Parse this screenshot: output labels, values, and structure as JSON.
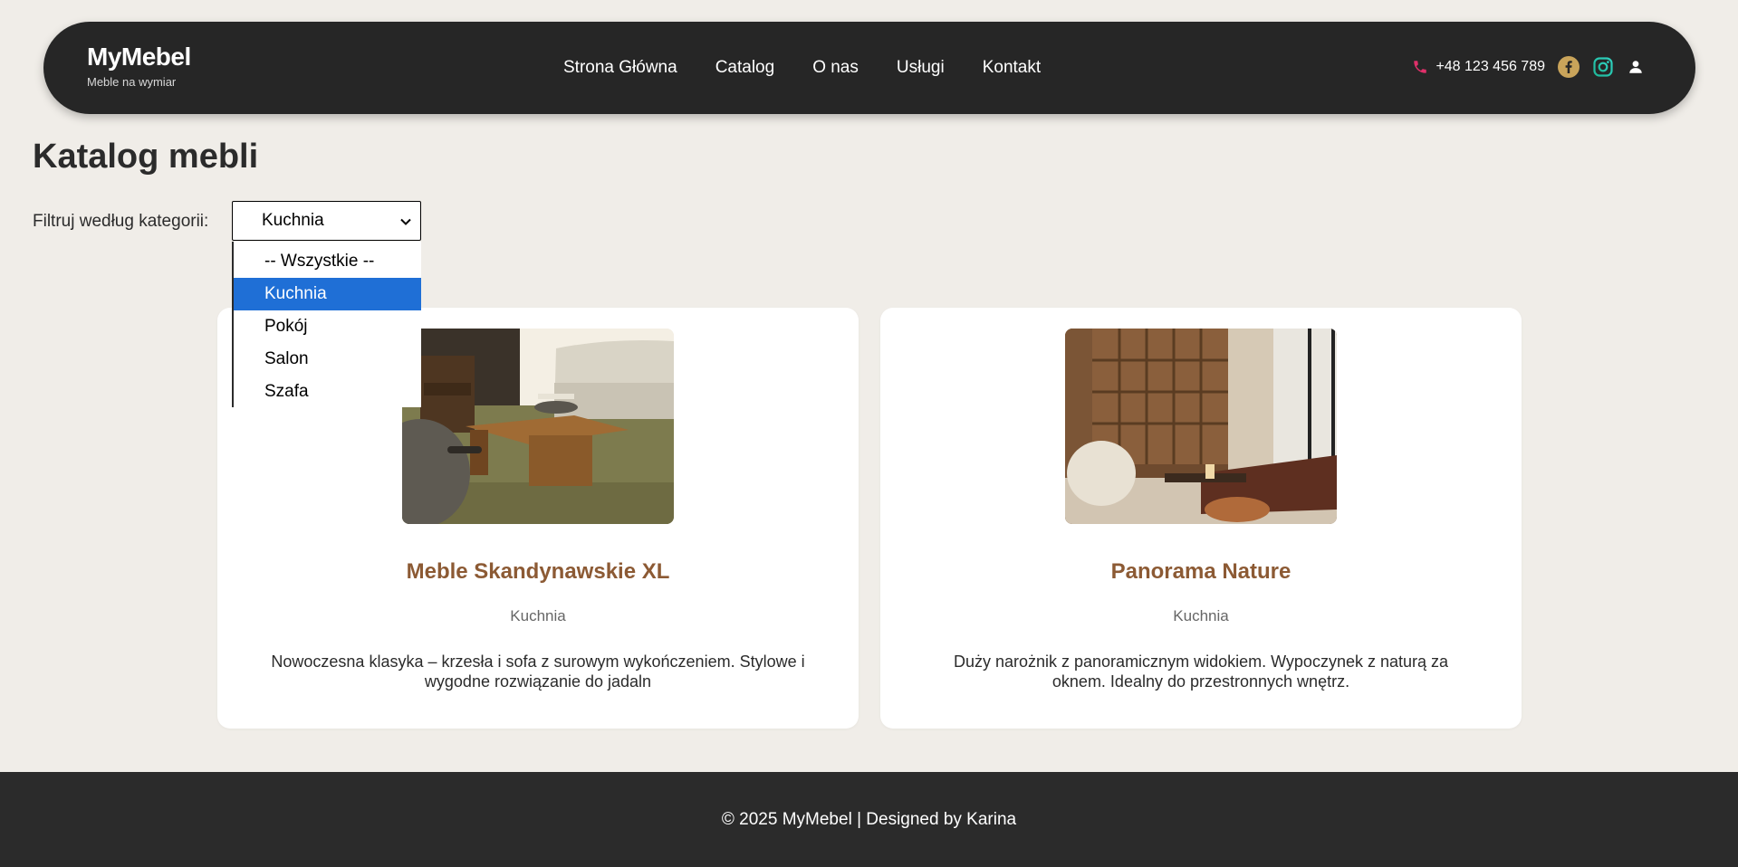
{
  "header": {
    "brand_name": "MyMebel",
    "brand_tagline": "Meble na wymiar",
    "nav": [
      "Strona Główna",
      "Catalog",
      "O nas",
      "Usługi",
      "Kontakt"
    ],
    "phone": "+48 123 456 789",
    "icons": [
      "phone-icon",
      "facebook-icon",
      "instagram-icon",
      "user-icon"
    ]
  },
  "main": {
    "title": "Katalog mebli",
    "filter_label": "Filtruj według kategorii:",
    "filter_selected": "Kuchnia",
    "filter_options": [
      "-- Wszystkie --",
      "Kuchnia",
      "Pokój",
      "Salon",
      "Szafa"
    ],
    "cards": [
      {
        "title": "Meble Skandynawskie XL",
        "category": "Kuchnia",
        "description": "Nowoczesna klasyka – krzesła i sofa z surowym wykończeniem. Stylowe i wygodne rozwiązanie do jadaln"
      },
      {
        "title": "Panorama Nature",
        "category": "Kuchnia",
        "description": "Duży narożnik z panoramicznym widokiem. Wypoczynek z naturą za oknem. Idealny do przestronnych wnętrz."
      }
    ]
  },
  "footer": {
    "text": "© 2025 MyMebel | Designed by Karina"
  },
  "colors": {
    "background": "#f0ede8",
    "header": "#262626",
    "accent_brown": "#8c5a34",
    "select_highlight": "#1f6fd6",
    "facebook": "#c9a45a",
    "phone": "#e0306a"
  }
}
